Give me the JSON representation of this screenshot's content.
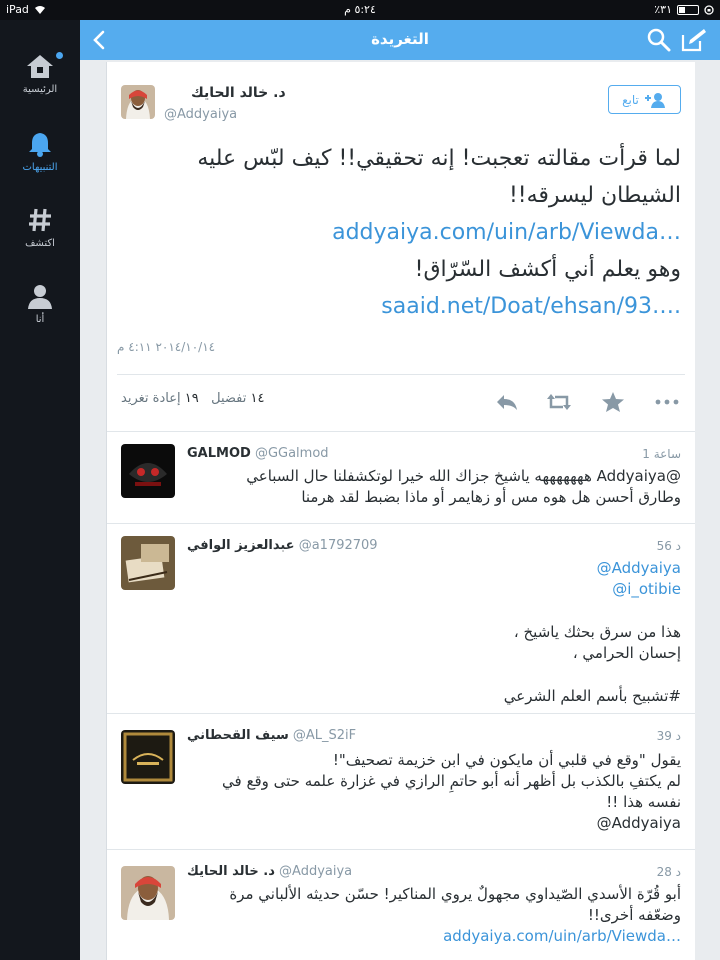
{
  "status_bar": {
    "device": "iPad",
    "time": "٥:٢٤ م",
    "battery": "٪٣١"
  },
  "sidebar": {
    "items": [
      {
        "label": "الرئيسية",
        "icon": "home-icon"
      },
      {
        "label": "التنبيهات",
        "icon": "bell-icon"
      },
      {
        "label": "اكتشف",
        "icon": "hashtag-icon"
      },
      {
        "label": "أنا",
        "icon": "person-icon"
      }
    ]
  },
  "navbar": {
    "title": "التغريدة"
  },
  "main_tweet": {
    "author_name": "د. خالد الحايك",
    "handle": "@Addyaiya",
    "follow_label": "تابع",
    "text_line1": "لما قرأت مقالته تعجبت! إنه تحقيقي!! كيف لبّس عليه الشيطان ليسرقه!!",
    "link1": "addyaiya.com/uin/arb/Viewda…",
    "text_line2": "وهو يعلم أني أكشف السّرّاق!",
    "link2": "saaid.net/Doat/ehsan/93….",
    "date": "٢٠١٤/١٠/١٤ ٤:١١ م",
    "favorites_count": "١٤",
    "favorites_label": "تفضيل",
    "retweets_count": "١٩",
    "retweets_label": "إعادة تغريد"
  },
  "replies": [
    {
      "name": "GALMOD",
      "handle": "@GGalmod",
      "time": "1 ساعة",
      "line1": "@Addyaiya هههههههه ياشيخ جزاك الله خيرا لوتكشفلنا حال السباعي",
      "line2": "وطارق أحسن هل هوه مس أو زهايمر أو ماذا بضبط لقد هرمنا"
    },
    {
      "name": "عبدالعزيز الوافي",
      "handle": "@a1792709",
      "time": "56 د",
      "line1": "@Addyaiya",
      "line2": "@i_otibie",
      "line3": "هذا من سرق بحثك ياشيخ ،",
      "line4": "إحسان الحرامي ،",
      "line5": "#تشبيح بأسم العلم الشرعي"
    },
    {
      "name": "سيف القحطاني",
      "handle": "@AL_S2iF",
      "time": "39 د",
      "line1": "يقول \"وقع في قلبي أن مايكون في ابن خزيمة تصحيف\"!",
      "line2": "لم يكتفِ بالكذب بل أظهر أنه أبو حاتمِ الرازي في غزارة علمه حتى وقع في",
      "line3": "نفسه هذا !!",
      "line4": "@Addyaiya"
    },
    {
      "name": "د. خالد الحايك",
      "handle": "@Addyaiya",
      "time": "28 د",
      "line1": "أبو قُرّة الأسدي الصّيداوي مجهولٌ يروي المناكير! حسّن حديثه الألباني مرة",
      "line2": "وضعّفه أخرى!!",
      "link": "addyaiya.com/uin/arb/Viewda…"
    }
  ],
  "colors": {
    "accent": "#55acee",
    "link": "#3b94d9",
    "sidebar_bg": "#13171d"
  }
}
